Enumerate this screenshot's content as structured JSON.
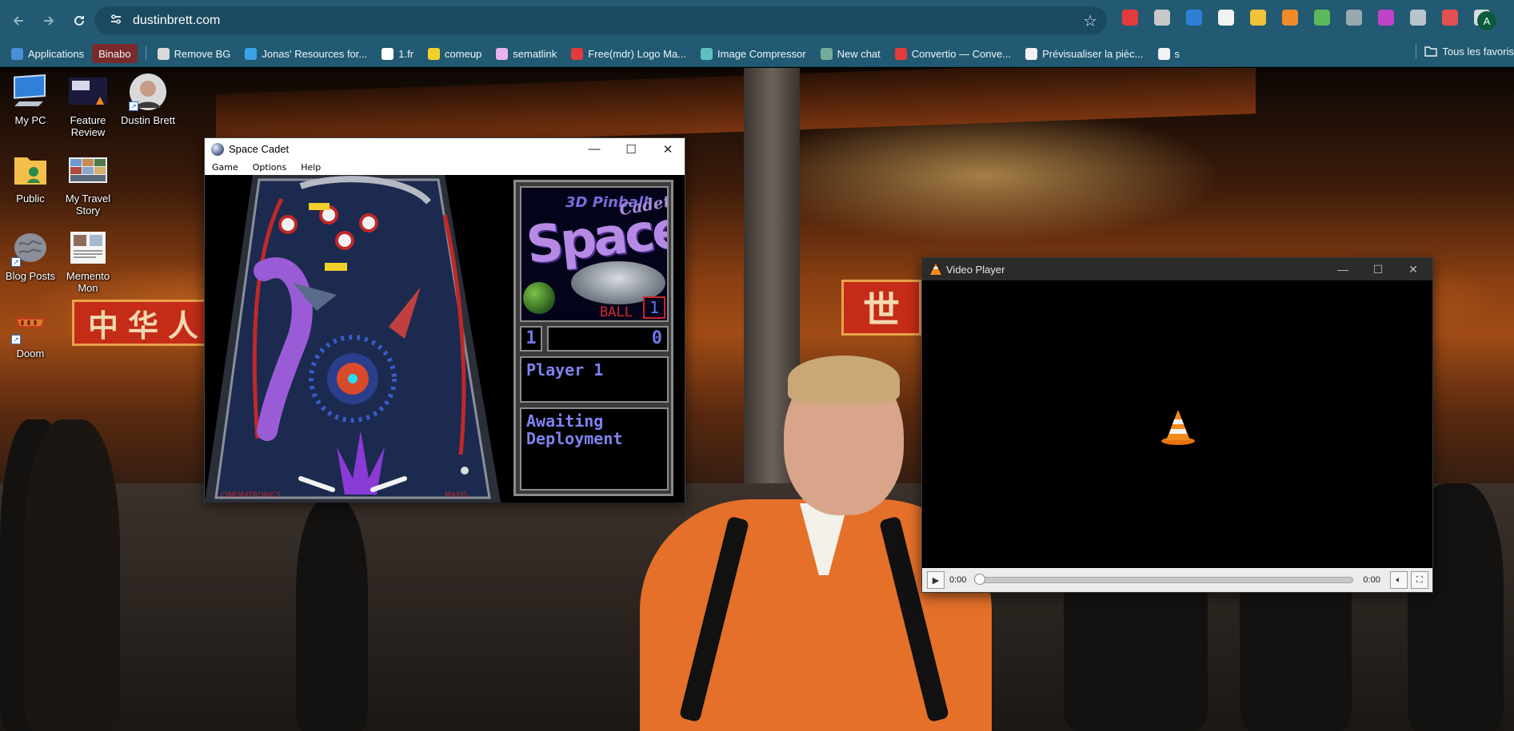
{
  "browser": {
    "url": "dustinbrett.com",
    "profile_initial": "A",
    "bookmarks": [
      {
        "label": "Applications",
        "color": "#4a8fd8"
      },
      {
        "label": "Binabo",
        "color": "#7a2a2a",
        "pill": true
      },
      {
        "label": "Remove BG",
        "color": "#d9d9d9"
      },
      {
        "label": "Jonas' Resources for...",
        "color": "#3ca2e8"
      },
      {
        "label": "1.fr",
        "color": "#ffffff"
      },
      {
        "label": "comeup",
        "color": "#f2d02b"
      },
      {
        "label": "sematlink",
        "color": "#e8b4f0"
      },
      {
        "label": "Free(mdr) Logo Ma...",
        "color": "#e23b3b"
      },
      {
        "label": "Image Compressor",
        "color": "#5fc0c0"
      },
      {
        "label": "New chat",
        "color": "#74aa9c"
      },
      {
        "label": "Convertio — Conve...",
        "color": "#e33b3b"
      },
      {
        "label": "Prévisualiser la pièc...",
        "color": "#f2f2f2"
      },
      {
        "label": "s",
        "color": "#f2f2f2"
      }
    ],
    "bookmarks_right": "Tous les favoris",
    "extension_colors": [
      "#e23b3b",
      "#c8c8c8",
      "#2d7fd6",
      "#f2f2f2",
      "#f2c23b",
      "#f08a2a",
      "#5cb85c",
      "#9aa8b0",
      "#c042c8",
      "#b8c4cc",
      "#e35050",
      "#d6dde2"
    ]
  },
  "desktop": {
    "icons": [
      {
        "name": "My PC"
      },
      {
        "name": "Feature Review"
      },
      {
        "name": "Dustin Brett"
      },
      {
        "name": "Public"
      },
      {
        "name": "My Travel Story"
      },
      {
        "name": "Blog Posts"
      },
      {
        "name": "Memento Mon"
      },
      {
        "name": "Doom"
      }
    ],
    "sign_left_text": "中华人",
    "sign_right_text": "世"
  },
  "space_cadet": {
    "title": "Space Cadet",
    "menu": [
      "Game",
      "Options",
      "Help"
    ],
    "logo_line1": "3D Pinball",
    "logo_line2": "Space",
    "logo_line3": "Cadet",
    "ball_label": "BALL",
    "ball_number": "1",
    "player_number": "1",
    "score": "0",
    "message_1": "Player 1",
    "message_2_line1": "Awaiting",
    "message_2_line2": "Deployment",
    "table_label_left": "CINEMATRONICS",
    "table_label_right": "MAXIS"
  },
  "video_player": {
    "title": "Video Player",
    "time_current": "0:00",
    "time_total": "0:00",
    "progress": 0.0
  }
}
